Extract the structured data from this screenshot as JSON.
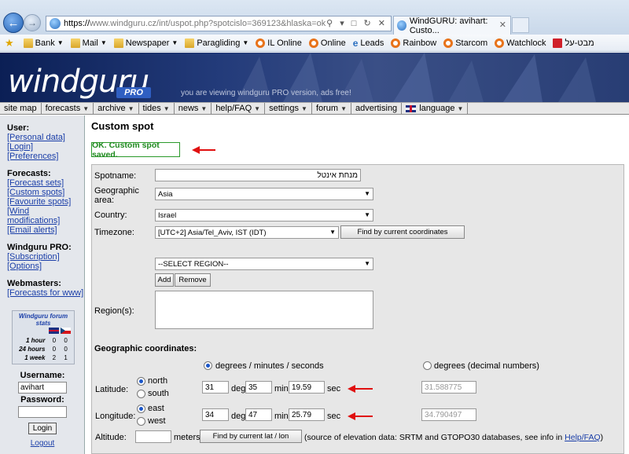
{
  "browser": {
    "url_scheme": "https://",
    "url_rest": "www.windguru.cz/int/uspot.php?spotcislo=369123&hlaska=ok",
    "tab_title": "WindGURU: avihart: Custo...",
    "favorites": [
      {
        "label": "Bank",
        "icon": "folder-icon",
        "dropdown": true
      },
      {
        "label": "Mail",
        "icon": "folder-icon",
        "dropdown": true
      },
      {
        "label": "Newspaper",
        "icon": "folder-icon",
        "dropdown": true
      },
      {
        "label": "Paragliding",
        "icon": "folder-icon",
        "dropdown": true
      },
      {
        "label": "IL Online",
        "icon": "ring-icon",
        "dropdown": false
      },
      {
        "label": "Online",
        "icon": "ring-icon",
        "dropdown": false
      },
      {
        "label": "Leads",
        "icon": "ie-icon",
        "dropdown": false
      },
      {
        "label": "Rainbow",
        "icon": "ring-icon",
        "dropdown": false
      },
      {
        "label": "Starcom",
        "icon": "ring-icon",
        "dropdown": false
      },
      {
        "label": "Watchlock",
        "icon": "ring-icon",
        "dropdown": false
      },
      {
        "label": "מבט-על",
        "icon": "red-square-icon",
        "dropdown": false
      }
    ]
  },
  "banner": {
    "logo": "windguru",
    "logo_pro": "PRO",
    "message": "you are viewing windguru PRO version, ads free!"
  },
  "menu": [
    {
      "label": "site map",
      "dropdown": false
    },
    {
      "label": "forecasts",
      "dropdown": true
    },
    {
      "label": "archive",
      "dropdown": true
    },
    {
      "label": "tides",
      "dropdown": true
    },
    {
      "label": "news",
      "dropdown": true
    },
    {
      "label": "help/FAQ",
      "dropdown": true
    },
    {
      "label": "settings",
      "dropdown": true
    },
    {
      "label": "forum",
      "dropdown": true
    },
    {
      "label": "advertising",
      "dropdown": false
    },
    {
      "label": "language",
      "dropdown": true
    }
  ],
  "sidebar": {
    "user_head": "User:",
    "user_links": [
      "[Personal data]",
      "[Login]",
      "[Preferences]"
    ],
    "forecasts_head": "Forecasts:",
    "forecasts_links": [
      "[Forecast sets]",
      "[Custom spots]",
      "[Favourite spots]",
      "[Wind modifications]",
      "[Email alerts]"
    ],
    "pro_head": "Windguru PRO:",
    "pro_links": [
      "[Subscription]",
      "[Options]"
    ],
    "webmasters_head": "Webmasters:",
    "webmasters_links": [
      "[Forecasts for www]"
    ],
    "stats": {
      "title": "Windguru forum stats",
      "rows": [
        {
          "label": "1 hour",
          "en": "0",
          "cz": "0"
        },
        {
          "label": "24 hours",
          "en": "0",
          "cz": "0"
        },
        {
          "label": "1 week",
          "en": "2",
          "cz": "1"
        }
      ]
    },
    "username_label": "Username:",
    "username_value": "avihart",
    "password_label": "Password:",
    "login_button": "Login",
    "logout": "Logout"
  },
  "main": {
    "title": "Custom spot",
    "ok_message": "OK. Custom spot saved.",
    "spotname_label": "Spotname:",
    "spotname_value": "מנחת אינטל",
    "area_label_1": "Geographic",
    "area_label_2": "area:",
    "area_value": "Asia",
    "country_label": "Country:",
    "country_value": "Israel",
    "timezone_label": "Timezone:",
    "timezone_value": "[UTC+2] Asia/Tel_Aviv, IST (IDT)",
    "find_coords_button": "Find by current coordinates",
    "region_select": "--SELECT REGION--",
    "add_button": "Add",
    "remove_button": "Remove",
    "regions_label": "Region(s):",
    "geo_head": "Geographic coordinates:",
    "mode_dms": "degrees / minutes / seconds",
    "mode_decimal": "degrees (decimal numbers)",
    "latitude_label": "Latitude:",
    "north": "north",
    "south": "south",
    "lat_deg": "31",
    "lat_min": "35",
    "lat_sec": "19.59",
    "lat_decimal": "31.588775",
    "longitude_label": "Longitude:",
    "east": "east",
    "west": "west",
    "lon_deg": "34",
    "lon_min": "47",
    "lon_sec": "25.79",
    "lon_decimal": "34.790497",
    "unit_deg": "deg",
    "unit_min": "min",
    "unit_sec": "sec",
    "altitude_label": "Altitude:",
    "altitude_unit": "meters",
    "find_latlon_button": "Find by current lat / lon",
    "elevation_note": "(source of elevation data: SRTM and GTOPO30 databases, see info in",
    "help_link": "Help/FAQ",
    "note_close": ")"
  }
}
